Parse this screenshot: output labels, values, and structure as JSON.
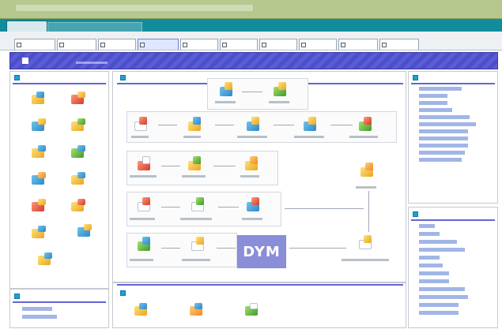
{
  "window": {
    "title": "",
    "tabs": [
      "",
      "",
      "",
      "",
      "",
      "",
      "",
      "",
      "",
      ""
    ],
    "active_tab_index": 3
  },
  "banner": {
    "title": ""
  },
  "left_panel": {
    "title": "",
    "items": [
      "",
      "",
      "",
      "",
      "",
      "",
      "",
      "",
      "",
      "",
      "",
      "",
      "",
      "",
      "",
      "",
      ""
    ]
  },
  "left_bottom_panel": {
    "title": "",
    "links": [
      "",
      ""
    ]
  },
  "center_panel": {
    "title": "",
    "watermark": "DYM"
  },
  "center_bottom_panel": {
    "title": "",
    "items": [
      "",
      "",
      ""
    ]
  },
  "right_top_panel": {
    "title": "",
    "links": [
      "",
      "",
      "",
      "",
      "",
      "",
      "",
      "",
      "",
      "",
      ""
    ]
  },
  "right_bottom_panel": {
    "title": "",
    "links": [
      "",
      "",
      "",
      "",
      "",
      "",
      "",
      "",
      "",
      "",
      "",
      ""
    ]
  },
  "colors": {
    "title_bar": "#128c9c",
    "banner": "#4d4fc9",
    "accent_rule": "#6366d1",
    "top_bar": "#b7c88e"
  },
  "icons": [
    "folder-icon",
    "document-icon",
    "chart-icon",
    "person-icon",
    "arrow-right-icon",
    "arrow-down-icon",
    "monitor-icon",
    "gear-icon"
  ]
}
